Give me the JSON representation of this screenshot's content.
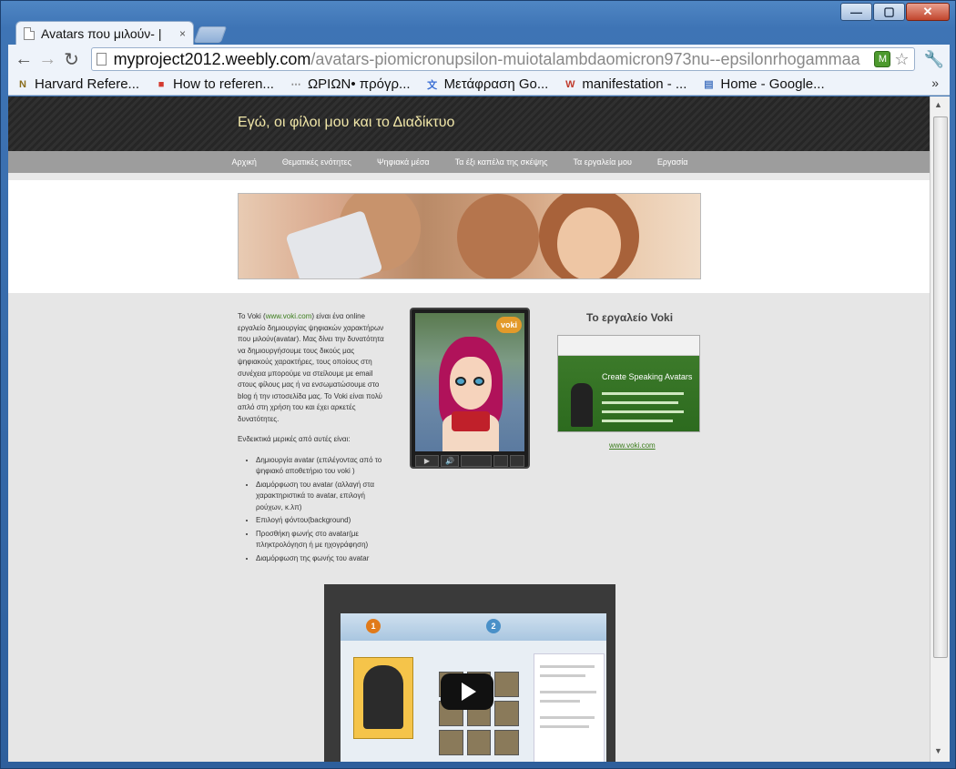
{
  "window": {
    "tab_title": "Avatars που μιλούν- |",
    "tab_close": "×",
    "minimize": "—",
    "maximize": "▢",
    "close": "✕"
  },
  "toolbar": {
    "back": "←",
    "forward": "→",
    "reload": "↻",
    "url_host": "myproject2012.weebly.com",
    "url_path": "/avatars-piomicronupsilon-muiotalambdaomicron973nu--epsilonrhogammaa",
    "extension": "M",
    "star": "☆",
    "wrench": "🔧"
  },
  "bookmarks": [
    {
      "label": "Harvard Refere...",
      "icon": "N",
      "icon_color": "#8a6d1c"
    },
    {
      "label": "How to referen...",
      "icon": "■",
      "icon_color": "#d43a2f"
    },
    {
      "label": "ΩΡΙΩΝ• πρόγρ...",
      "icon": "⋯",
      "icon_color": "#888888"
    },
    {
      "label": "Μετάφραση Go...",
      "icon": "文",
      "icon_color": "#3b6fd4"
    },
    {
      "label": "manifestation - ...",
      "icon": "W",
      "icon_color": "#c03a2b"
    },
    {
      "label": "Home - Google...",
      "icon": "▤",
      "icon_color": "#4a78c2"
    }
  ],
  "bookmarks_more": "»",
  "site": {
    "title": "Εγώ, οι φίλοι μου και το Διαδίκτυο",
    "nav": [
      "Αρχική",
      "Θεματικές ενότητες",
      "Ψηφιακά μέσα",
      "Τα έξι καπέλα της σκέψης",
      "Τα εργαλεία μου",
      "Εργασία"
    ]
  },
  "content": {
    "intro_before_link": "Το Voki (",
    "intro_link": "www.voki.com",
    "intro_after_link": ") είναι ένα online εργαλείο δημιουργίας ψηφιακών χαρακτήρων που μιλούν(avatar). Μας δίνει την δυνατότητα να δημιουργήσουμε τους δικούς μας ψηφιακούς χαρακτήρες, τους οποίους στη συνέχεια μπορούμε να στείλουμε με email στους φίλους μας ή να ενσωματώσουμε στο blog ή την ιστοσελίδα μας. Το Voki είναι πολύ απλό στη χρήση του και έχει αρκετές δυνατότητες.",
    "list_intro": "Ενδεικτικά μερικές από αυτές είναι:",
    "features": [
      "Δημιουργία avatar (επιλέγοντας από το ψηφιακό αποθετήριο του voki )",
      "Διαμόρφωση του avatar (αλλαγή στα χαρακτηριστικά το avatar, επιλογή ρούχων, κ.λπ)",
      "Επιλογή φόντου(background)",
      "Προσθήκη φωνής στο avatar(με πληκτρολόγηση ή με ηχογράφηση)",
      "Διαμόρφωση της φωνής του avatar"
    ]
  },
  "voki_player": {
    "logo": "voki",
    "play": "▶",
    "volume": "🔊"
  },
  "sidebar": {
    "heading": "Το εργαλείο Voki",
    "screenshot_title": "Create Speaking Avatars",
    "link": "www.voki.com"
  },
  "video": {
    "step1": "1",
    "step2": "2"
  },
  "scroll": {
    "up": "▲",
    "down": "▼"
  }
}
